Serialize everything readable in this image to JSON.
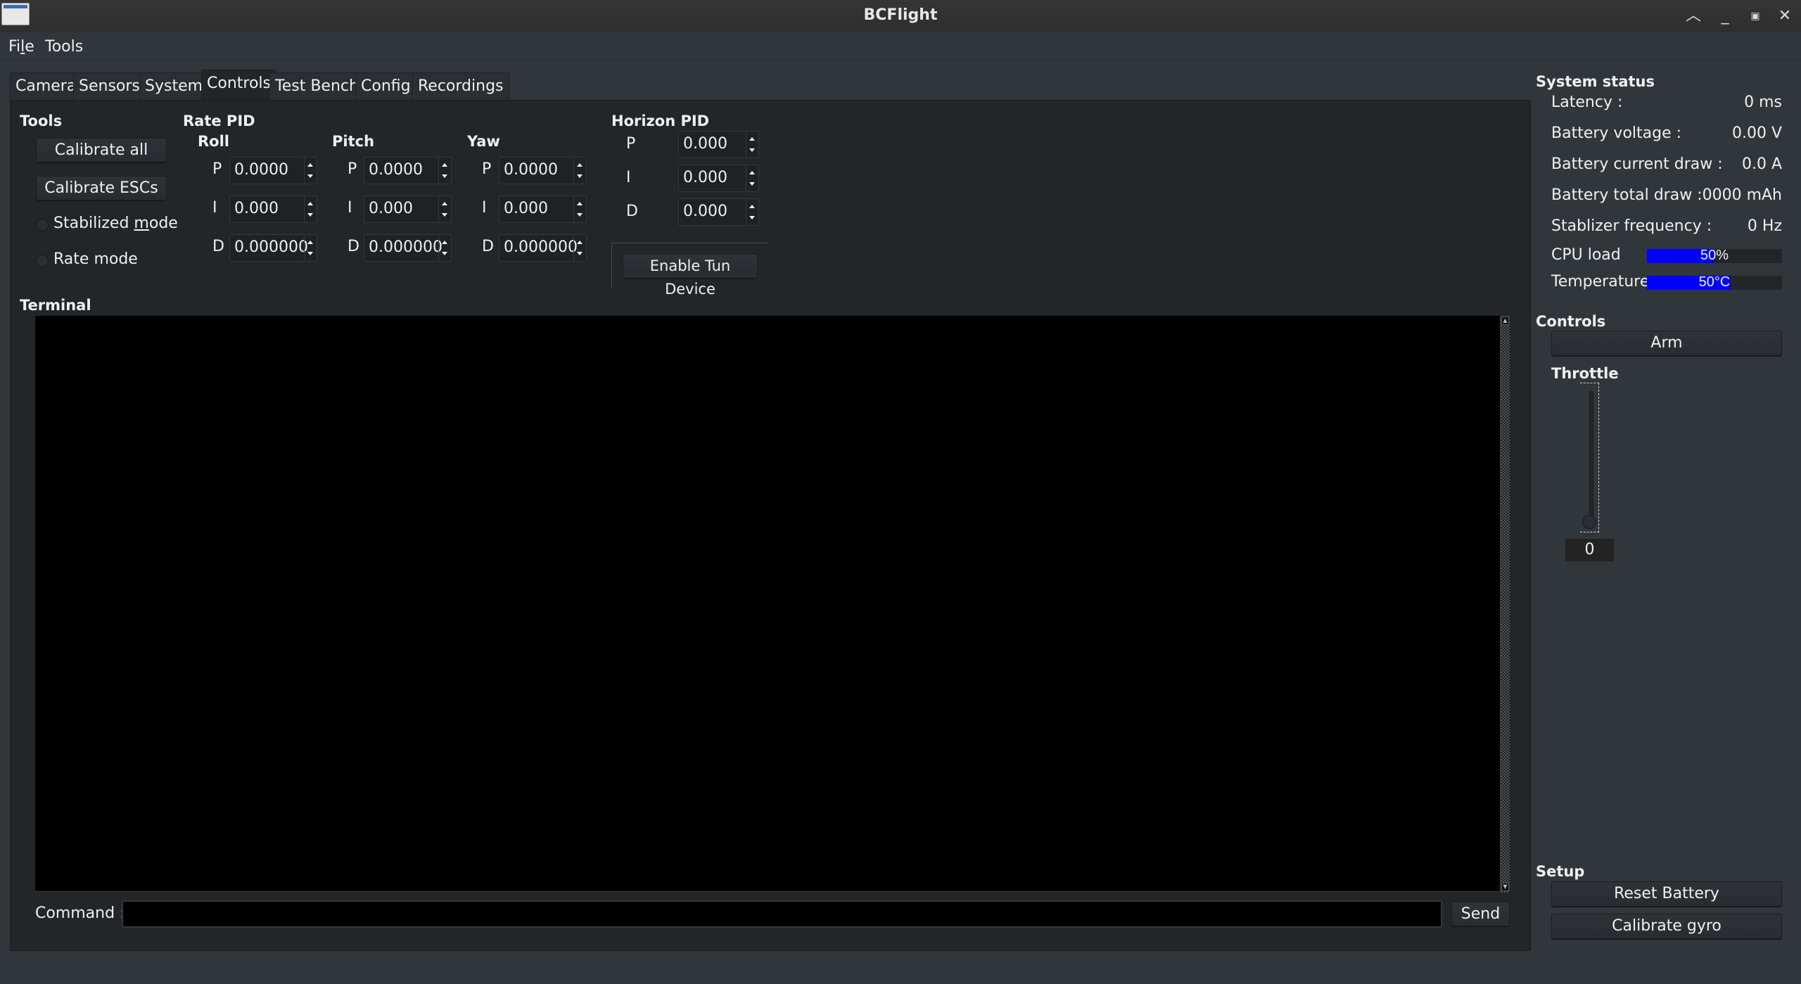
{
  "window": {
    "title": "BCFlight",
    "controls": {
      "shade": "^",
      "minimize": "_",
      "maximize": "▫",
      "close": "✕"
    }
  },
  "menu": {
    "items": [
      {
        "label": "File",
        "mnemonic_index": 2
      },
      {
        "label": "Tools"
      }
    ]
  },
  "tabs": [
    {
      "label": "Camera",
      "active": false
    },
    {
      "label": "Sensors",
      "active": false
    },
    {
      "label": "System",
      "active": false
    },
    {
      "label": "Controls",
      "active": true
    },
    {
      "label": "Test Bench",
      "active": false
    },
    {
      "label": "Config",
      "active": false
    },
    {
      "label": "Recordings",
      "active": false
    }
  ],
  "tools": {
    "heading": "Tools",
    "calibrate_all": "Calibrate all",
    "calibrate_escs": "Calibrate ESCs",
    "stabilized_mode": "Stabilized mode",
    "rate_mode": "Rate mode",
    "stabilized_checked": false,
    "rate_checked": false
  },
  "rate_pid": {
    "heading": "Rate PID",
    "axes": [
      {
        "name": "Roll",
        "p": "0.0000",
        "i": "0.000",
        "d": "0.000000"
      },
      {
        "name": "Pitch",
        "p": "0.0000",
        "i": "0.000",
        "d": "0.000000"
      },
      {
        "name": "Yaw",
        "p": "0.0000",
        "i": "0.000",
        "d": "0.000000"
      }
    ],
    "labels": {
      "p": "P",
      "i": "I",
      "d": "D"
    }
  },
  "horizon_pid": {
    "heading": "Horizon PID",
    "p": "0.000",
    "i": "0.000",
    "d": "0.000",
    "labels": {
      "p": "P",
      "i": "I",
      "d": "D"
    },
    "enable_tun": "Enable Tun Device"
  },
  "terminal": {
    "heading": "Terminal",
    "output": "",
    "command_label": "Command :",
    "command_value": "",
    "send": "Send"
  },
  "system_status": {
    "heading": "System status",
    "rows": [
      {
        "label": "Latency :",
        "value": "0 ms"
      },
      {
        "label": "Battery voltage :",
        "value": "0.00 V"
      },
      {
        "label": "Battery current draw :",
        "value": "0.0 A"
      },
      {
        "label": "Battery total draw :",
        "value": "0000 mAh"
      },
      {
        "label": "Stablizer frequency :",
        "value": "0 Hz"
      }
    ],
    "cpu_load": {
      "label": "CPU load",
      "text": "50%",
      "fraction": 0.5
    },
    "temperature": {
      "label": "Temperature",
      "text": "50°C",
      "fraction": 0.62
    }
  },
  "controls": {
    "heading": "Controls",
    "arm": "Arm",
    "throttle_label": "Throttle",
    "throttle_value": "0",
    "throttle_fraction": 0
  },
  "setup": {
    "heading": "Setup",
    "reset_battery": "Reset Battery",
    "calibrate_gyro": "Calibrate gyro"
  },
  "colors": {
    "progress_fill": "#0000ff",
    "background": "#31363b",
    "pane": "#232629"
  }
}
